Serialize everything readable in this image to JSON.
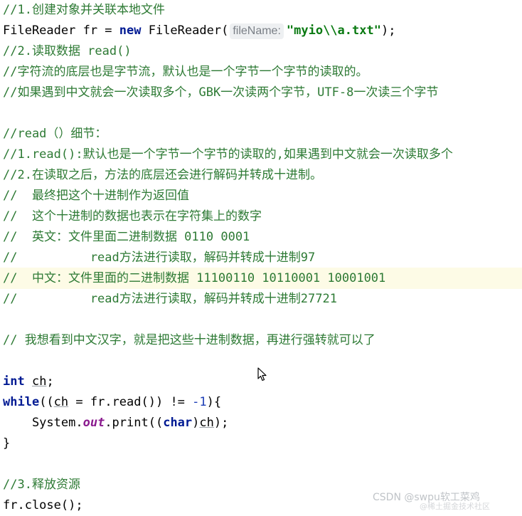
{
  "lines": {
    "l1": "//1.创建对象并关联本地文件",
    "l2_a": "FileReader fr = ",
    "l2_new": "new",
    "l2_b": " FileReader(",
    "l2_hint": "fileName:",
    "l2_str": "\"myio\\\\a.txt\"",
    "l2_end": ");",
    "l3": "//2.读取数据 read()",
    "l4": "//字符流的底层也是字节流，默认也是一个字节一个字节的读取的。",
    "l5": "//如果遇到中文就会一次读取多个，GBK一次读两个字节，UTF-8一次读三个字节",
    "l6": "//read（）细节：",
    "l7": "//1.read():默认也是一个字节一个字节的读取的,如果遇到中文就会一次读取多个",
    "l8": "//2.在读取之后，方法的底层还会进行解码并转成十进制。",
    "l9": "//  最终把这个十进制作为返回值",
    "l10": "//  这个十进制的数据也表示在字符集上的数字",
    "l11": "//  英文：文件里面二进制数据 0110 0001",
    "l12": "//          read方法进行读取，解码并转成十进制97",
    "l13": "//  中文：文件里面的二进制数据 11100110 10110001 10001001",
    "l14": "//          read方法进行读取，解码并转成十进制27721",
    "l15": "// 我想看到中文汉字，就是把这些十进制数据，再进行强转就可以了",
    "l16_kw": "int",
    "l16_var": "ch",
    "l16_end": ";",
    "l17_kw": "while",
    "l17_a": "((",
    "l17_var": "ch",
    "l17_b": " = fr.read()) != ",
    "l17_num": "-1",
    "l17_c": "){",
    "l18_a": "    System.",
    "l18_out": "out",
    "l18_b": ".print((",
    "l18_kw": "char",
    "l18_c": ")",
    "l18_var": "ch",
    "l18_d": ");",
    "l19": "}",
    "l20": "//3.释放资源",
    "l21": "fr.close();"
  },
  "watermark": {
    "main": "CSDN @swpu软工菜鸡",
    "sub": "@稀土掘金技术社区"
  },
  "colors": {
    "comment": "#2d7a34",
    "keyword": "#001a93",
    "string": "#0a7a12",
    "number": "#1a3cb5",
    "static_field": "#8a1a8e",
    "current_line": "#fdfbe6"
  },
  "icons": {
    "cursor": "mouse-pointer-icon"
  }
}
